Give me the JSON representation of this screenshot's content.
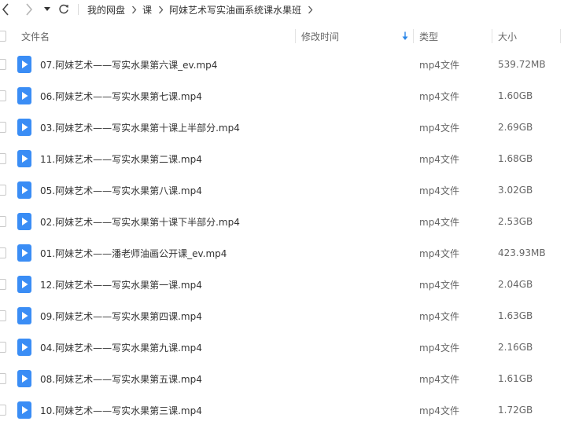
{
  "nav": {
    "back_icon": "chevron-left-icon",
    "forward_icon": "chevron-right-icon",
    "history_icon": "caret-down-icon",
    "refresh_icon": "refresh-icon"
  },
  "breadcrumb": [
    {
      "label": "我的网盘"
    },
    {
      "label": "课"
    },
    {
      "label": "阿妹艺术写实油画系统课水果班"
    }
  ],
  "columns": {
    "name": "文件名",
    "modified": "修改时间",
    "type": "类型",
    "size": "大小"
  },
  "colors": {
    "icon_blue": "#3a8df5",
    "text": "#333333",
    "muted": "#666666"
  },
  "files": [
    {
      "name": "07.阿妹艺术——写实水果第六课_ev.mp4",
      "type": "mp4文件",
      "size": "539.72MB"
    },
    {
      "name": "06.阿妹艺术——写实水果第七课.mp4",
      "type": "mp4文件",
      "size": "1.60GB"
    },
    {
      "name": "03.阿妹艺术——写实水果第十课上半部分.mp4",
      "type": "mp4文件",
      "size": "2.69GB"
    },
    {
      "name": "11.阿妹艺术——写实水果第二课.mp4",
      "type": "mp4文件",
      "size": "1.68GB"
    },
    {
      "name": "05.阿妹艺术——写实水果第八课.mp4",
      "type": "mp4文件",
      "size": "3.02GB"
    },
    {
      "name": "02.阿妹艺术——写实水果第十课下半部分.mp4",
      "type": "mp4文件",
      "size": "2.53GB"
    },
    {
      "name": "01.阿妹艺术——潘老师油画公开课_ev.mp4",
      "type": "mp4文件",
      "size": "423.93MB"
    },
    {
      "name": "12.阿妹艺术——写实水果第一课.mp4",
      "type": "mp4文件",
      "size": "2.04GB"
    },
    {
      "name": "09.阿妹艺术——写实水果第四课.mp4",
      "type": "mp4文件",
      "size": "1.63GB"
    },
    {
      "name": "04.阿妹艺术——写实水果第九课.mp4",
      "type": "mp4文件",
      "size": "2.16GB"
    },
    {
      "name": "08.阿妹艺术——写实水果第五课.mp4",
      "type": "mp4文件",
      "size": "1.61GB"
    },
    {
      "name": "10.阿妹艺术——写实水果第三课.mp4",
      "type": "mp4文件",
      "size": "1.72GB"
    }
  ]
}
